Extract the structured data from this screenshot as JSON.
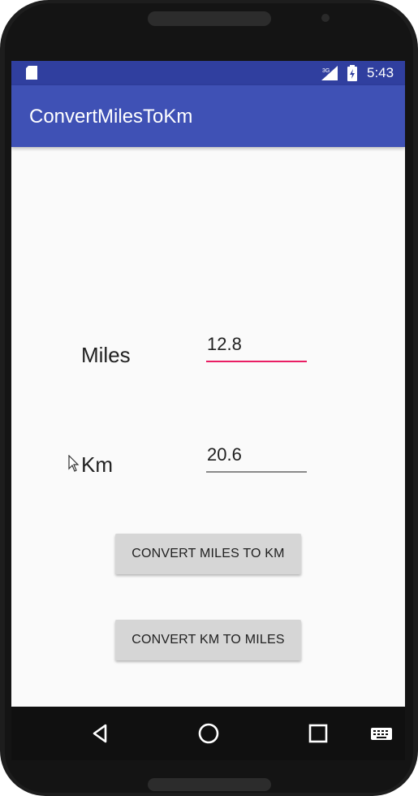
{
  "status_bar": {
    "time": "5:43",
    "network": "3G",
    "icons": [
      "sd-card-icon",
      "signal-icon",
      "battery-icon"
    ],
    "color": "#303f9f"
  },
  "app_bar": {
    "title": "ConvertMilesToKm",
    "color": "#3f51b5"
  },
  "form": {
    "miles_label": "Miles",
    "miles_value": "12.8",
    "km_label": "Km",
    "km_value": "20.6",
    "focused_field": "miles",
    "accent_color": "#e91e63"
  },
  "buttons": {
    "miles_to_km": "CONVERT MILES TO KM",
    "km_to_miles": "CONVERT KM TO MILES"
  },
  "nav_bar": {
    "icons": [
      "back-icon",
      "home-icon",
      "recents-icon",
      "keyboard-icon"
    ]
  }
}
